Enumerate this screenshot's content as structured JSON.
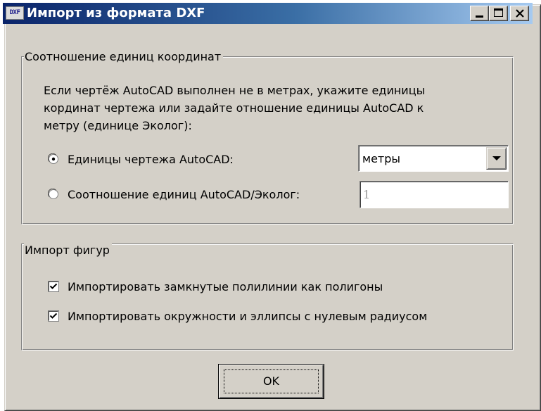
{
  "window": {
    "title": "Импорт из формата DXF",
    "icon_label": "DXF",
    "controls": [
      "minimize-icon",
      "maximize-icon",
      "close-icon"
    ]
  },
  "units_group": {
    "legend": "Соотношение единиц координат",
    "description_lines": [
      "Если чертёж AutoCAD выполнен не в метрах, укажите единицы",
      "кординат чертежа или задайте отношение единицы AutoCAD к",
      "метру (единице Эколог):"
    ],
    "option_units": {
      "label": "Единицы чертежа AutoCAD:",
      "selected": true
    },
    "units_select": {
      "value": "метры"
    },
    "option_ratio": {
      "label": "Соотношение единиц AutoCAD/Эколог:",
      "selected": false
    },
    "ratio_input": {
      "value": "1",
      "disabled": true
    }
  },
  "shapes_group": {
    "legend": "Импорт фигур",
    "checkbox_polylines": {
      "label": "Импортировать замкнутые полилинии как полигоны",
      "checked": true
    },
    "checkbox_circles": {
      "label": "Импортировать окружности и эллипсы с нулевым радиусом",
      "checked": true
    }
  },
  "buttons": {
    "ok_label": "OK"
  },
  "colors": {
    "dialog_face": "#d4d0c8",
    "title_start": "#0a246a",
    "title_end": "#a6caf0",
    "disabled_text": "#9a9a9a"
  }
}
